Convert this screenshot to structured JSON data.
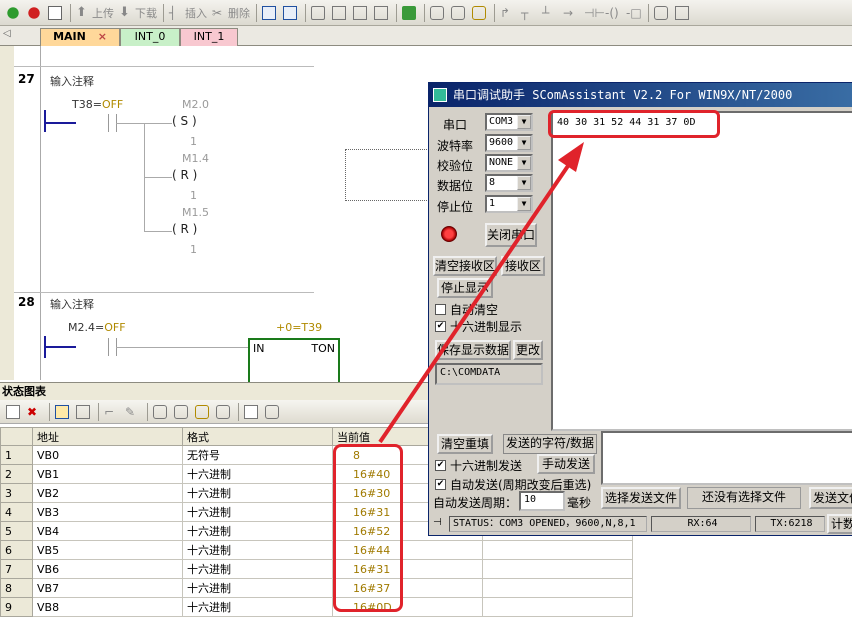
{
  "toolbar": {
    "upload_label": "上传",
    "download_label": "下载",
    "insert_label": "插入",
    "delete_label": "删除"
  },
  "tabs": [
    {
      "label": "MAIN"
    },
    {
      "label": "INT_0"
    },
    {
      "label": "INT_1"
    }
  ],
  "ladder": {
    "network27": {
      "number": "27",
      "comment": "输入注释",
      "contact_label": "T38=",
      "contact_value": "OFF",
      "coils": [
        {
          "addr": "M2.0",
          "letter": "S",
          "count": "1"
        },
        {
          "addr": "M1.4",
          "letter": "R",
          "count": "1"
        },
        {
          "addr": "M1.5",
          "letter": "R",
          "count": "1"
        }
      ]
    },
    "network28": {
      "number": "28",
      "comment": "输入注释",
      "contact_label": "M2.4=",
      "contact_value": "OFF",
      "timer_value": "+0=T39",
      "timer_in": "IN",
      "timer_type": "TON"
    }
  },
  "status_chart": {
    "title": "状态图表",
    "headers": [
      "",
      "地址",
      "格式",
      "当前值",
      ""
    ],
    "rows": [
      {
        "idx": "1",
        "addr": "VB0",
        "format": "无符号",
        "value": "8"
      },
      {
        "idx": "2",
        "addr": "VB1",
        "format": "十六进制",
        "value": "16#40"
      },
      {
        "idx": "3",
        "addr": "VB2",
        "format": "十六进制",
        "value": "16#30"
      },
      {
        "idx": "4",
        "addr": "VB3",
        "format": "十六进制",
        "value": "16#31"
      },
      {
        "idx": "5",
        "addr": "VB4",
        "format": "十六进制",
        "value": "16#52"
      },
      {
        "idx": "6",
        "addr": "VB5",
        "format": "十六进制",
        "value": "16#44"
      },
      {
        "idx": "7",
        "addr": "VB6",
        "format": "十六进制",
        "value": "16#31"
      },
      {
        "idx": "8",
        "addr": "VB7",
        "format": "十六进制",
        "value": "16#37"
      },
      {
        "idx": "9",
        "addr": "VB8",
        "format": "十六进制",
        "value": "16#0D"
      }
    ]
  },
  "serial": {
    "title": "串口调试助手 SComAssistant V2.2 For WIN9X/NT/2000",
    "port_label": "串口",
    "port_value": "COM3",
    "baud_label": "波特率",
    "baud_value": "9600",
    "parity_label": "校验位",
    "parity_value": "NONE",
    "databits_label": "数据位",
    "databits_value": "8",
    "stopbits_label": "停止位",
    "stopbits_value": "1",
    "close_port_label": "关闭串口",
    "clear_rx_label": "清空接收区",
    "rx_tab_label": "接收区",
    "stop_display_label": "停止显示",
    "auto_clear_label": "自动清空",
    "hex_display_label": "十六进制显示",
    "save_data_label": "保存显示数据",
    "change_label": "更改",
    "path_value": "C:\\COMDATA",
    "rx_text": "40 30 31 52 44 31 37 0D",
    "clear_resend_label": "清空重填",
    "send_chars_label": "发送的字符/数据",
    "hex_send_label": "十六进制发送",
    "manual_send_label": "手动发送",
    "auto_send_label": "自动发送(周期改变后重选)",
    "period_label": "自动发送周期：",
    "period_value": "10",
    "ms_label": "毫秒",
    "select_file_label": "选择发送文件",
    "no_file_label": "还没有选择文件",
    "send_file_label": "发送文件",
    "status_text": "STATUS：COM3 OPENED，9600,N,8,1",
    "rx_count": "RX:64",
    "tx_count": "TX:6218",
    "count_label": "计数"
  },
  "colors": {
    "accent_red": "#e0232b",
    "title_blue": "#0a246a",
    "value_gold": "#a07a00"
  }
}
